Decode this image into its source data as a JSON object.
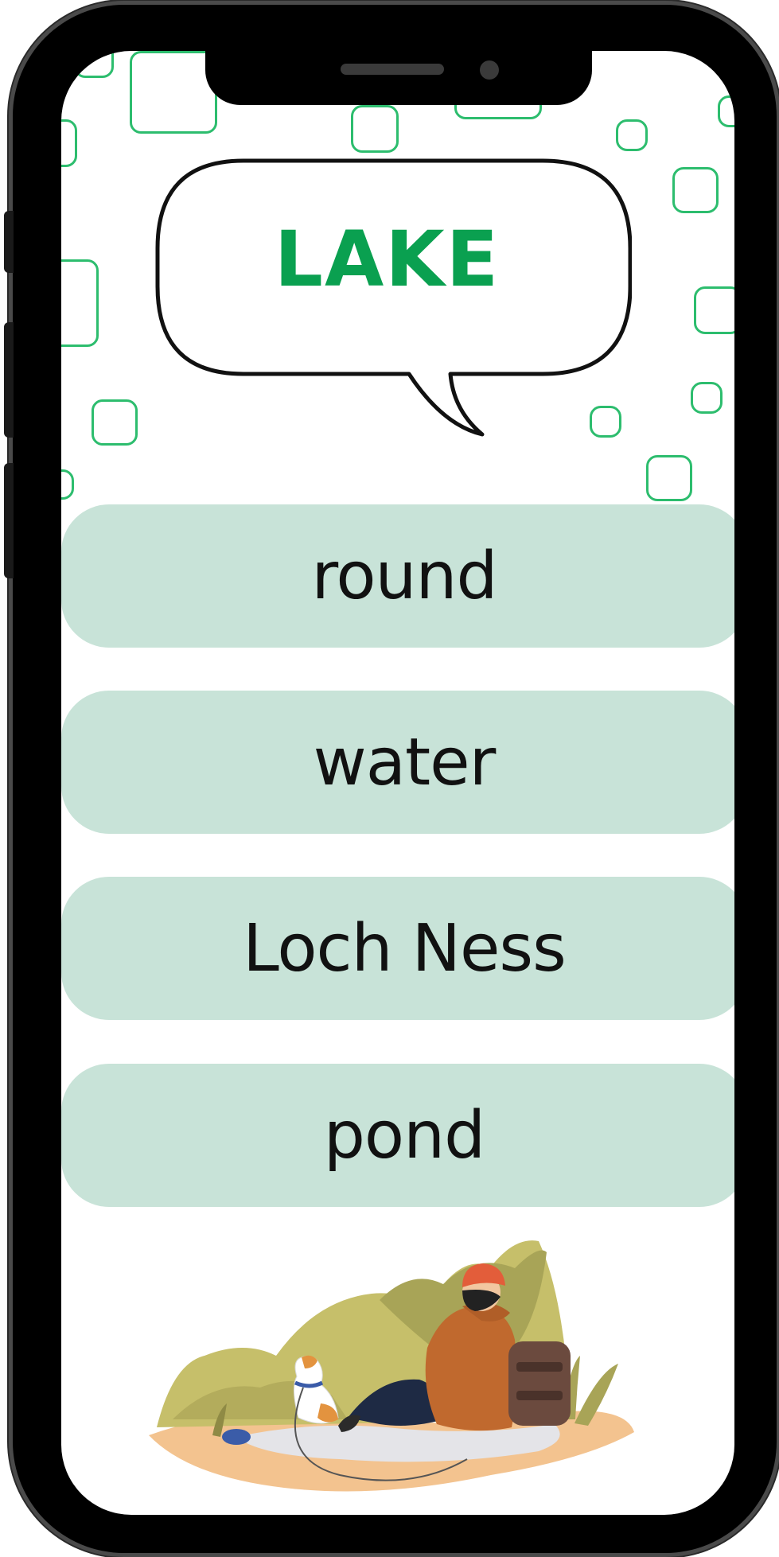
{
  "card": {
    "word": "LAKE"
  },
  "answers": [
    {
      "label": "round"
    },
    {
      "label": "water"
    },
    {
      "label": "Loch Ness"
    },
    {
      "label": "pond"
    }
  ],
  "colors": {
    "accent": "#0aa050",
    "deco_outline": "#2dbd6e",
    "answer_bg": "#c8e3d8",
    "frame": "#000000"
  },
  "icons": {
    "illustration": "hiker-with-dog-illustration"
  }
}
